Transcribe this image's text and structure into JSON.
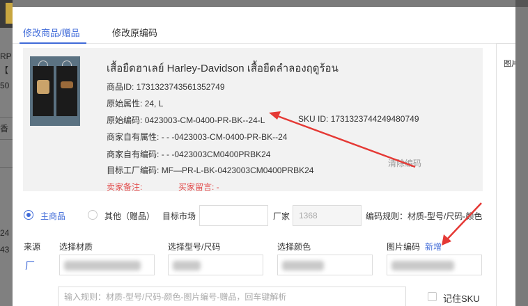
{
  "backdrop": {
    "fragments": [
      "RP",
      "【",
      "50",
      "香",
      "24",
      "43"
    ]
  },
  "tabs": [
    {
      "label": "修改商品/赠品",
      "active": true
    },
    {
      "label": "修改原编码",
      "active": false
    }
  ],
  "product": {
    "title": "เสื้อยืดฮาเลย์ Harley-Davidson เสื้อยืดลำลองฤดูร้อน",
    "id_label": "商品ID:",
    "id_value": "1731323743561352749",
    "attr_label": "原始属性:",
    "attr_value": "24, L",
    "code_label": "原始编码:",
    "code_value": "0423003-CM-0400-PR-BK--24-L",
    "sku_label": "SKU ID:",
    "sku_value": "1731323744249480749",
    "merchant_attr_label": "商家自有属性:",
    "merchant_attr_value": "- - -0423003-CM-0400-PR-BK--24",
    "merchant_code_label": "商家自有编码:",
    "merchant_code_value": "- - -0423003CM0400PRBK24",
    "factory_code_label": "目标工厂编码:",
    "factory_code_value": "MF—PR-L-BK-0423003CM0400PRBK24",
    "clear_link": "清除编码",
    "seller_note": "卖家备注:",
    "buyer_note": "买家留言: -"
  },
  "side_panel": {
    "label": "图片来"
  },
  "form": {
    "main_product": "主商品",
    "other_gift": "其他（赠品）",
    "target_market_label": "目标市场",
    "target_market_value": "",
    "factory_label": "厂家",
    "factory_value": "1368",
    "rule_text": "编码规则：材质-型号/尺码-颜色",
    "source_label": "来源",
    "source_value": "厂",
    "material_label": "选择材质",
    "model_label": "选择型号/尺码",
    "color_label": "选择颜色",
    "image_code_label": "图片编码",
    "add_link": "新增",
    "parse_placeholder": "输入规则：材质-型号/尺码-颜色-图片编号-赠品，回车键解析",
    "remember_sku": "记住SKU"
  },
  "colors": {
    "accent": "#3f6ad8",
    "annotation": "#e53935",
    "note_red": "#e24b4b"
  }
}
